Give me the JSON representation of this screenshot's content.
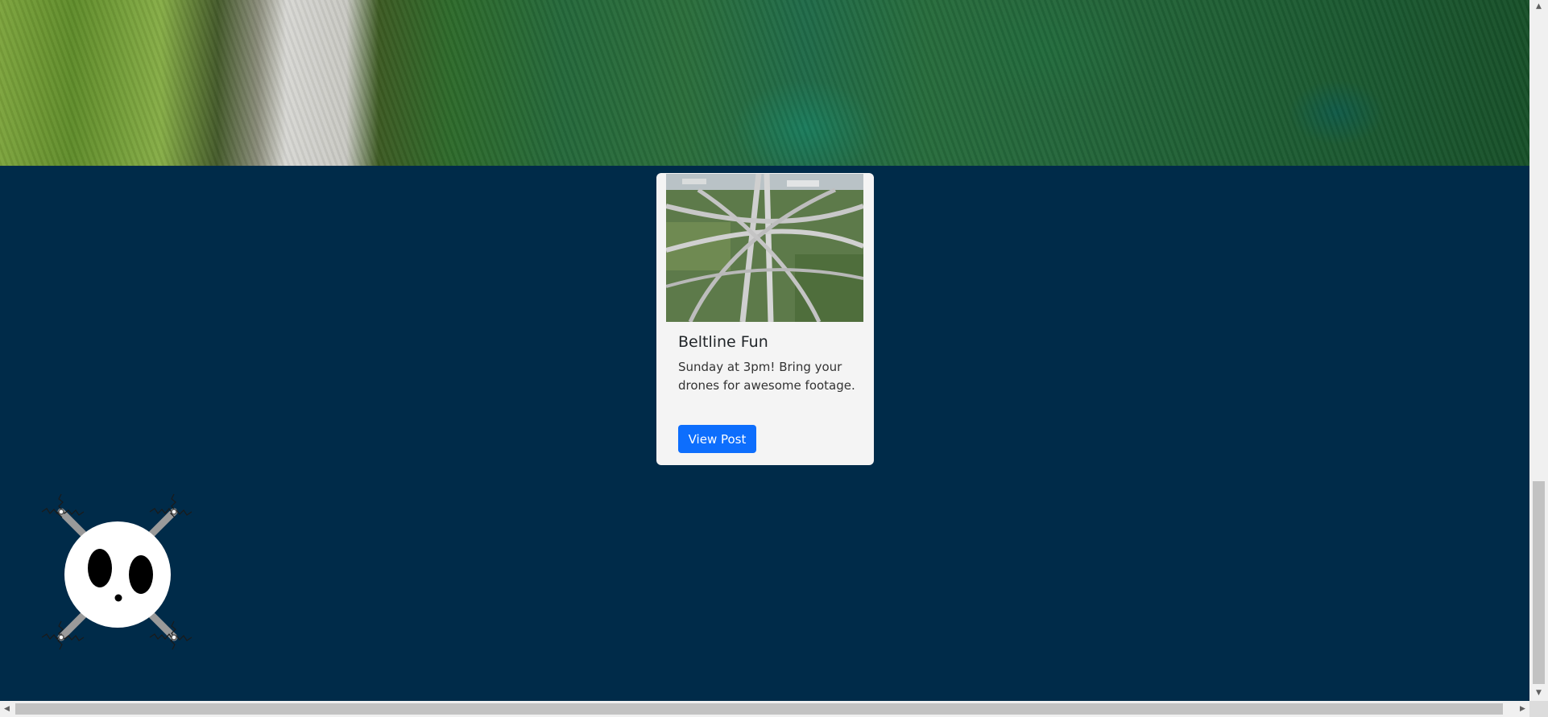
{
  "card": {
    "title": "Beltline Fun",
    "text": "Sunday at 3pm! Bring your drones for awesome footage.",
    "button_label": "View Post"
  },
  "icons": {
    "scroll_up": "▲",
    "scroll_down": "▼",
    "scroll_left": "◀",
    "scroll_right": "▶"
  },
  "colors": {
    "page_background": "#002b49",
    "card_background": "#f4f4f4",
    "button_background": "#0d6efd"
  }
}
